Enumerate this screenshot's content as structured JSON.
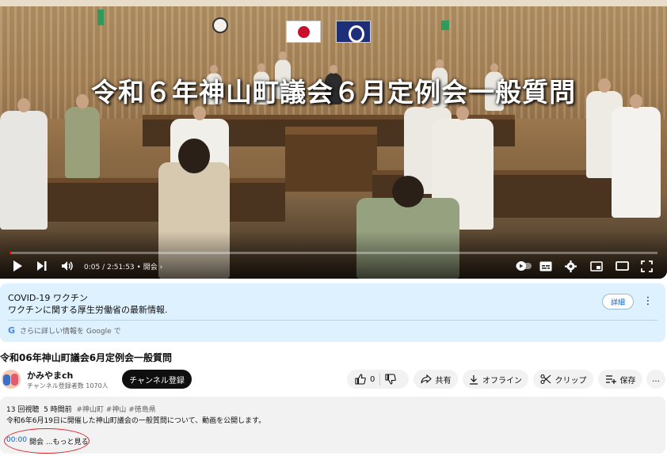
{
  "player": {
    "overlay_title": "令和６年神山町議会６月定例会一般質問",
    "time_display": "0:05 / 2:51:53 • 開会",
    "progress": 0.0005
  },
  "info_panel": {
    "title": "COVID-19 ワクチン",
    "description": "ワクチンに関する厚生労働省の最新情報.",
    "details_button": "詳細",
    "more_icon": "⋮",
    "google_text": "さらに詳しい情報を Google で",
    "google_mark": "G"
  },
  "video": {
    "title": "令和06年神山町議会6月定例会一般質問"
  },
  "channel": {
    "name": "かみやまch",
    "subscribers": "チャンネル登録者数 1070人",
    "subscribe_label": "チャンネル登録"
  },
  "actions": {
    "like_count": "0",
    "share_label": "共有",
    "offline_label": "オフライン",
    "clip_label": "クリップ",
    "save_label": "保存",
    "more_label": "…"
  },
  "description": {
    "views": "13 回視聴",
    "posted": "5 時間前",
    "tags": "#神山町 #神山 #徳島県",
    "text": "令和6年6月19日に開催した神山町議会の一般質問について、動画を公開します。",
    "chapter_time": "00:00",
    "chapter_label": "開会",
    "more_label": "...もっと見る"
  },
  "colors": {
    "accent_red": "#ff0000",
    "link_blue": "#065fd4",
    "info_bg": "#def1ff",
    "annotation_ring": "#d9262c"
  }
}
